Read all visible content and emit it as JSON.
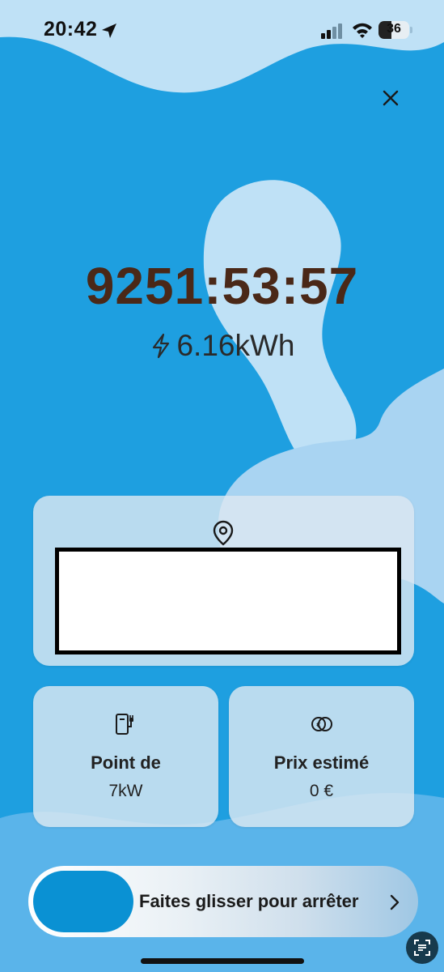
{
  "status_bar": {
    "time": "20:42",
    "battery_level": "36"
  },
  "session": {
    "elapsed_time": "9251:53:57",
    "energy": "6.16kWh"
  },
  "stats": {
    "point": {
      "title": "Point de",
      "value": "7kW"
    },
    "price": {
      "title": "Prix estimé",
      "value": "0 €"
    }
  },
  "slider": {
    "label": "Faites glisser pour arrêter"
  },
  "colors": {
    "background": "#1e9fe0",
    "wave_light": "#bfe1f6",
    "timer_text": "#4a2818",
    "knob": "#0a91d3"
  },
  "icons": {
    "location": "location-arrow-icon",
    "close": "close-icon",
    "energy": "lightning-icon",
    "station": "charging-station-icon",
    "price": "coins-icon",
    "scan": "text-scan-icon"
  }
}
